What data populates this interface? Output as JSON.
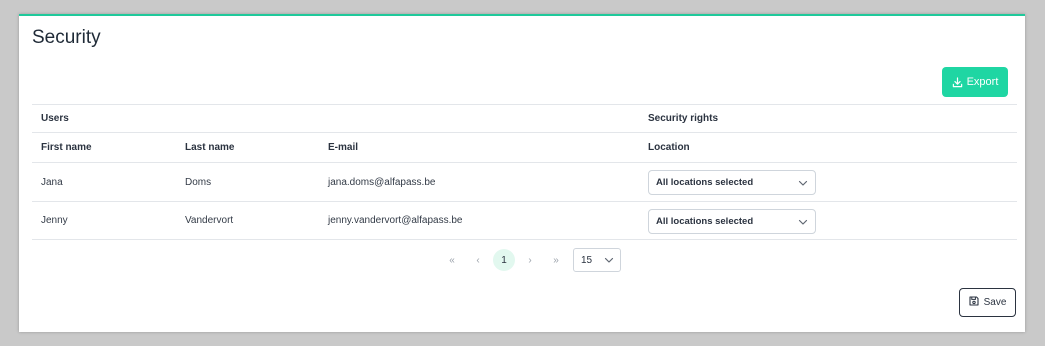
{
  "page": {
    "title": "Security"
  },
  "toolbar": {
    "export_label": "Export",
    "export_icon": "download-icon",
    "accent_color": "#1fd6a3"
  },
  "table": {
    "group_headers": {
      "users": "Users",
      "security_rights": "Security rights"
    },
    "columns": {
      "first_name": "First name",
      "last_name": "Last name",
      "email": "E-mail",
      "location": "Location"
    },
    "rows": [
      {
        "first_name": "Jana",
        "last_name": "Doms",
        "email": "jana.doms@alfapass.be",
        "location": "All locations selected"
      },
      {
        "first_name": "Jenny",
        "last_name": "Vandervort",
        "email": "jenny.vandervort@alfapass.be",
        "location": "All locations selected"
      }
    ]
  },
  "pagination": {
    "first_icon": "«",
    "prev_icon": "‹",
    "current_page": "1",
    "next_icon": "›",
    "last_icon": "»",
    "page_size": "15"
  },
  "footer": {
    "save_label": "Save",
    "save_icon": "floppy-disk-icon"
  }
}
